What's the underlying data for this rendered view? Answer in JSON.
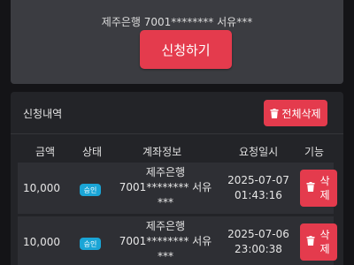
{
  "apply_panel": {
    "account_text": "제주은행 7001******** 서유***",
    "apply_button_label": "신청하기"
  },
  "history": {
    "title": "신청내역",
    "delete_all_label": "전체삭제",
    "columns": [
      "금액",
      "상태",
      "계좌정보",
      "요청일시",
      "기능"
    ],
    "rows": [
      {
        "amount": "10,000",
        "status": "승인",
        "bank": "제주은행",
        "account_line": "7001******** 서유",
        "account_tail": "***",
        "date": "2025-07-07",
        "time": "01:43:16",
        "delete_label_1": "삭",
        "delete_label_2": "제"
      },
      {
        "amount": "10,000",
        "status": "승인",
        "bank": "제주은행",
        "account_line": "7001******** 서유",
        "account_tail": "***",
        "date": "2025-07-06",
        "time": "23:00:38",
        "delete_label_1": "삭",
        "delete_label_2": "제"
      }
    ]
  },
  "colors": {
    "accent_red": "#e43b4d",
    "status_blue": "#1aa5d6",
    "background": "#141417"
  }
}
